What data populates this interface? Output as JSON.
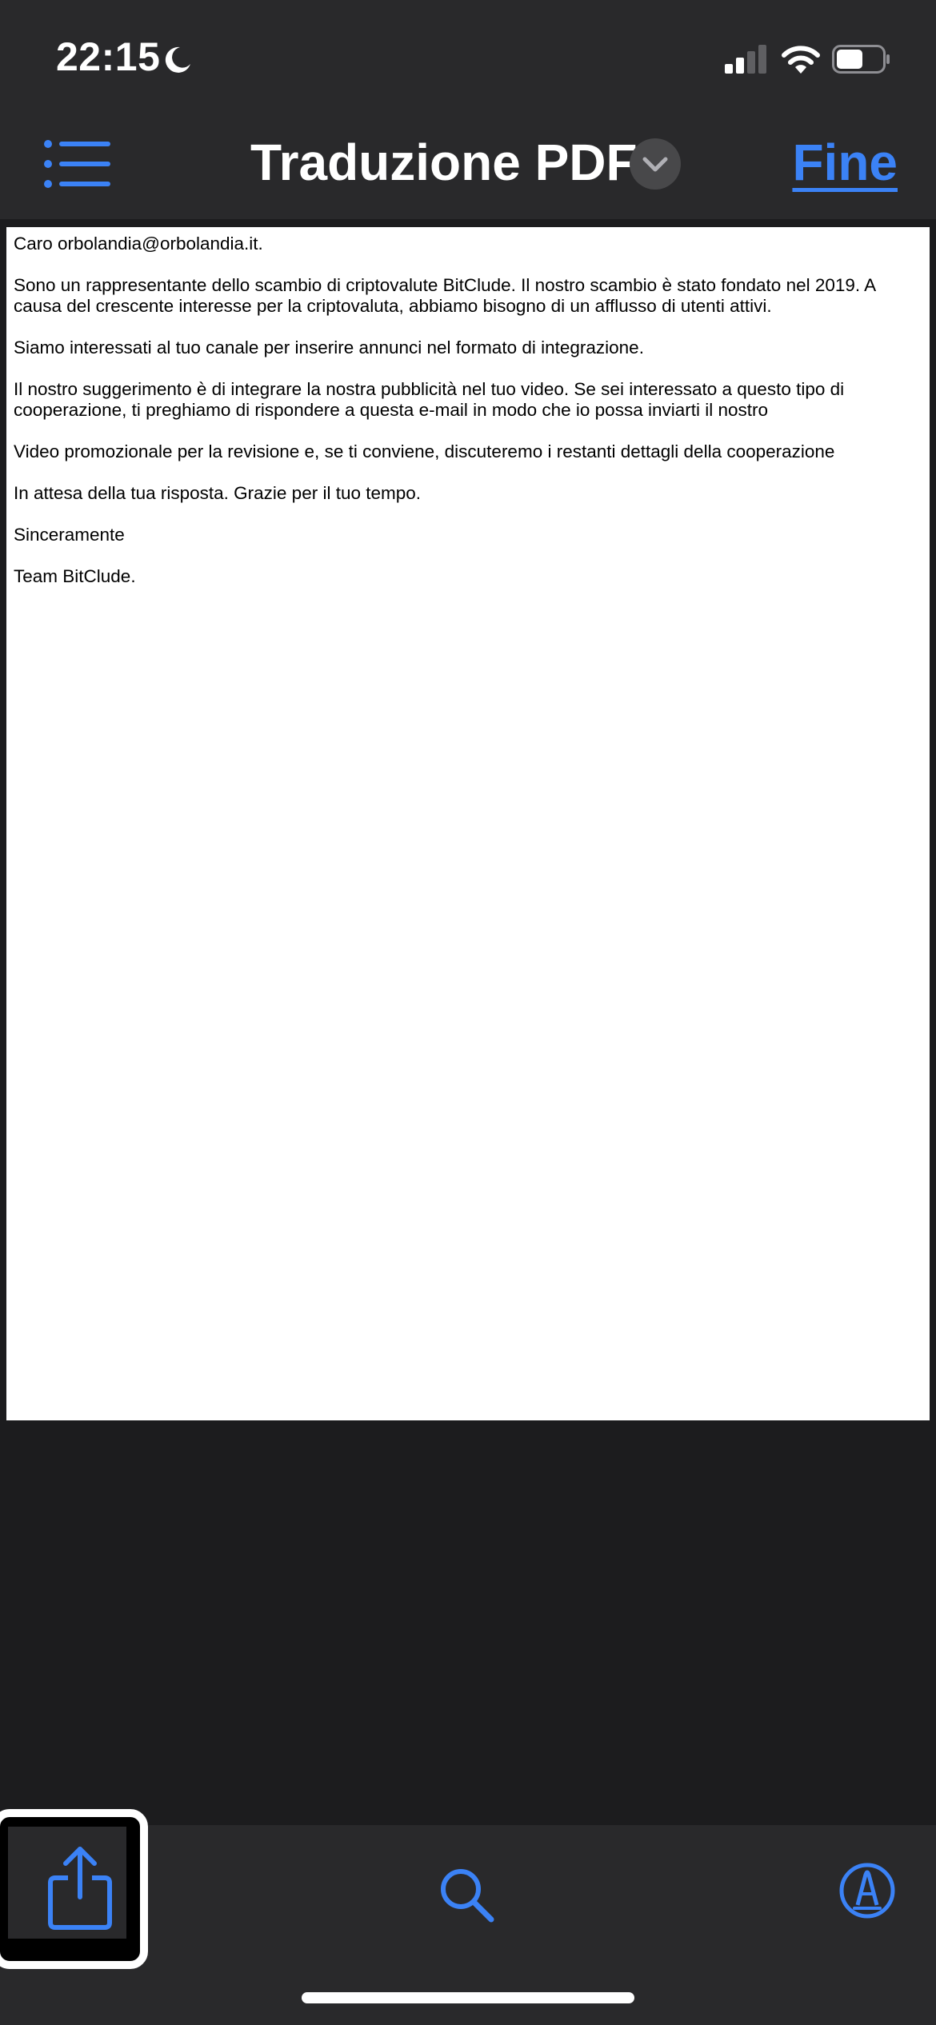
{
  "status_bar": {
    "time": "22:15",
    "icons": [
      "moon-icon",
      "cellular-signal-icon",
      "wifi-icon",
      "battery-icon"
    ]
  },
  "nav_bar": {
    "title": "Traduzione PDF",
    "done_label": "Fine",
    "icons": [
      "list-icon",
      "chevron-down-icon"
    ]
  },
  "document": {
    "paragraphs": [
      "Caro orbolandia@orbolandia.it.",
      "Sono un rappresentante dello scambio di criptovalute BitClude. Il nostro scambio è stato fondato nel 2019. A causa del crescente interesse per la criptovaluta, abbiamo bisogno di un afflusso di utenti attivi.",
      "Siamo interessati al tuo canale per inserire annunci nel formato di integrazione.",
      "Il nostro suggerimento è di integrare la nostra pubblicità nel tuo video. Se sei interessato a questo tipo di cooperazione, ti preghiamo di rispondere a questa e-mail in modo che io possa inviarti il nostro",
      "Video promozionale per la revisione e, se ti conviene, discuteremo i restanti dettagli della cooperazione",
      "In attesa della tua risposta. Grazie per il tuo tempo.",
      "Sinceramente",
      "Team BitClude."
    ]
  },
  "toolbar": {
    "icons": [
      "share-icon",
      "search-icon",
      "markup-icon"
    ]
  },
  "colors": {
    "accent": "#3b82f6",
    "bar_background": "#29292b",
    "screen_background": "#1c1c1e",
    "page_background": "#ffffff"
  }
}
